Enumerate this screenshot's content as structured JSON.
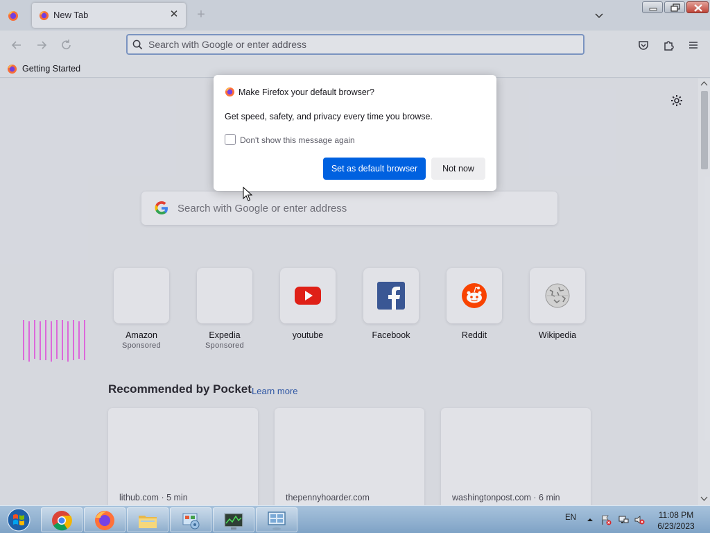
{
  "browser": {
    "tab": {
      "title": "New Tab"
    },
    "url_placeholder": "Search with Google or enter address",
    "bookmarks": [
      {
        "label": "Getting Started"
      }
    ]
  },
  "dialog": {
    "title": "Make Firefox your default browser?",
    "body": "Get speed, safety, and privacy every time you browse.",
    "checkbox_label": "Don't show this message again",
    "checkbox_checked": false,
    "primary_label": "Set as default browser",
    "secondary_label": "Not now"
  },
  "newtab": {
    "search_placeholder": "Search with Google or enter address",
    "top_sites": [
      {
        "name": "Amazon",
        "sponsored": "Sponsored",
        "icon": "blank"
      },
      {
        "name": "Expedia",
        "sponsored": "Sponsored",
        "icon": "blank"
      },
      {
        "name": "youtube",
        "icon": "youtube-icon"
      },
      {
        "name": "Facebook",
        "icon": "facebook-icon"
      },
      {
        "name": "Reddit",
        "icon": "reddit-icon"
      },
      {
        "name": "Wikipedia",
        "icon": "wikipedia-icon"
      }
    ],
    "pocket": {
      "heading": "Recommended by Pocket",
      "learn_more": "Learn more",
      "cards": [
        {
          "source": "lithub.com · 5 min"
        },
        {
          "source": "thepennyhoarder.com"
        },
        {
          "source": "washingtonpost.com · 6 min"
        }
      ]
    }
  },
  "taskbar": {
    "apps": [
      "chrome-icon",
      "firefox-icon",
      "file-explorer-icon",
      "control-panel-icon",
      "task-manager-icon",
      "remote-desktop-icon"
    ],
    "language": "EN",
    "time": "11:08 PM",
    "date": "6/23/2023"
  },
  "colors": {
    "accent": "#0061e0",
    "link": "#2f58a8",
    "youtube": "#e62117",
    "facebook": "#3b5998",
    "reddit": "#ff4500"
  }
}
